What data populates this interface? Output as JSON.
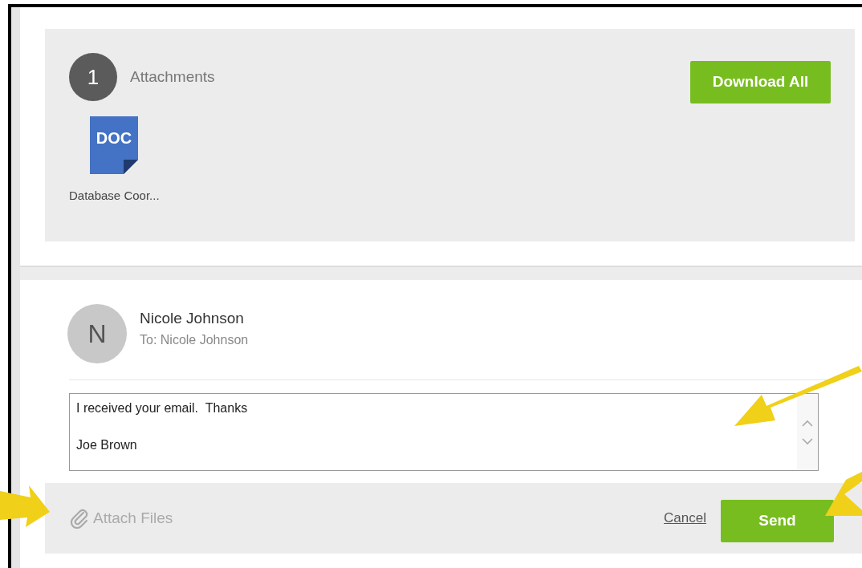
{
  "attachments": {
    "count": "1",
    "title": "Attachments",
    "download_button": "Download All",
    "files": [
      {
        "icon_label": "DOC",
        "name": "Database Coor..."
      }
    ]
  },
  "reply": {
    "avatar_initial": "N",
    "sender": "Nicole Johnson",
    "to": "To: Nicole Johnson",
    "message": "I received your email.  Thanks\n\nJoe Brown",
    "attach_label": "Attach Files",
    "cancel": "Cancel",
    "send": "Send"
  }
}
